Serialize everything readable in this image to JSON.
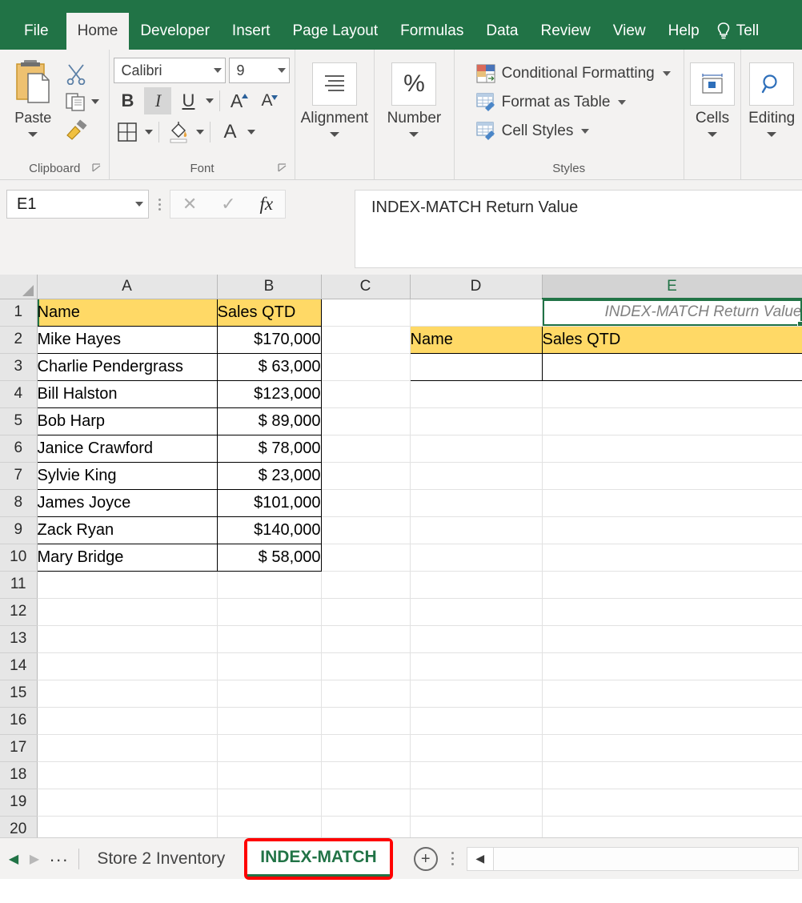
{
  "ribbon_tabs": [
    {
      "label": "File",
      "active": false
    },
    {
      "label": "Home",
      "active": true
    },
    {
      "label": "Developer",
      "active": false
    },
    {
      "label": "Insert",
      "active": false
    },
    {
      "label": "Page Layout",
      "active": false
    },
    {
      "label": "Formulas",
      "active": false
    },
    {
      "label": "Data",
      "active": false
    },
    {
      "label": "Review",
      "active": false
    },
    {
      "label": "View",
      "active": false
    },
    {
      "label": "Help",
      "active": false
    }
  ],
  "tell_me": "Tell",
  "ribbon": {
    "clipboard": {
      "label": "Clipboard",
      "paste_label": "Paste"
    },
    "font": {
      "label": "Font",
      "font_name": "Calibri",
      "font_size": "9",
      "bold": "B",
      "italic": "I",
      "underline": "U",
      "grow_font": "A",
      "shrink_font": "A",
      "font_color": "A"
    },
    "alignment": {
      "label": "Alignment"
    },
    "number": {
      "label": "Number",
      "icon_glyph": "%"
    },
    "styles": {
      "label": "Styles",
      "items": [
        "Conditional Formatting",
        "Format as Table",
        "Cell Styles"
      ]
    },
    "cells": {
      "label": "Cells"
    },
    "editing": {
      "label": "Editing"
    }
  },
  "formula_bar": {
    "name_box": "E1",
    "cancel_icon": "✕",
    "enter_icon": "✓",
    "function_icon": "fx",
    "formula_value": "INDEX-MATCH Return Value"
  },
  "grid": {
    "columns": [
      {
        "label": "A",
        "selected": false
      },
      {
        "label": "B",
        "selected": false
      },
      {
        "label": "C",
        "selected": false
      },
      {
        "label": "D",
        "selected": false
      },
      {
        "label": "E",
        "selected": true
      }
    ],
    "rows": [
      "1",
      "2",
      "3",
      "4",
      "5",
      "6",
      "7",
      "8",
      "9",
      "10",
      "11",
      "12",
      "13",
      "14",
      "15",
      "16",
      "17",
      "18",
      "19",
      "20"
    ],
    "left_table": {
      "headers": [
        "Name",
        "Sales QTD"
      ],
      "rows": [
        {
          "name": "Mike Hayes",
          "sales": "$170,000"
        },
        {
          "name": "Charlie Pendergrass",
          "sales": "$  63,000"
        },
        {
          "name": "Bill Halston",
          "sales": "$123,000"
        },
        {
          "name": "Bob Harp",
          "sales": "$  89,000"
        },
        {
          "name": "Janice Crawford",
          "sales": "$  78,000"
        },
        {
          "name": "Sylvie King",
          "sales": "$  23,000"
        },
        {
          "name": "James Joyce",
          "sales": "$101,000"
        },
        {
          "name": "Zack Ryan",
          "sales": "$140,000"
        },
        {
          "name": "Mary Bridge",
          "sales": "$  58,000"
        }
      ]
    },
    "right_table": {
      "title_cell": "INDEX-MATCH Return Value",
      "headers": [
        "Name",
        "Sales QTD"
      ],
      "blank_row": [
        "",
        ""
      ]
    },
    "selected_cell": "E1",
    "accent_selection_color": "#217346",
    "header_fill_color": "#FFD966"
  },
  "sheet_bar": {
    "prev_icon": "◀",
    "next_icon": "▶",
    "more_icon": "...",
    "tabs": [
      {
        "label": "Store 2 Inventory",
        "active": false,
        "highlight": false
      },
      {
        "label": "INDEX-MATCH",
        "active": true,
        "highlight": true
      }
    ],
    "add_sheet_icon": "+",
    "scroll_left_icon": "◀",
    "highlight_color": "#FF0000"
  }
}
